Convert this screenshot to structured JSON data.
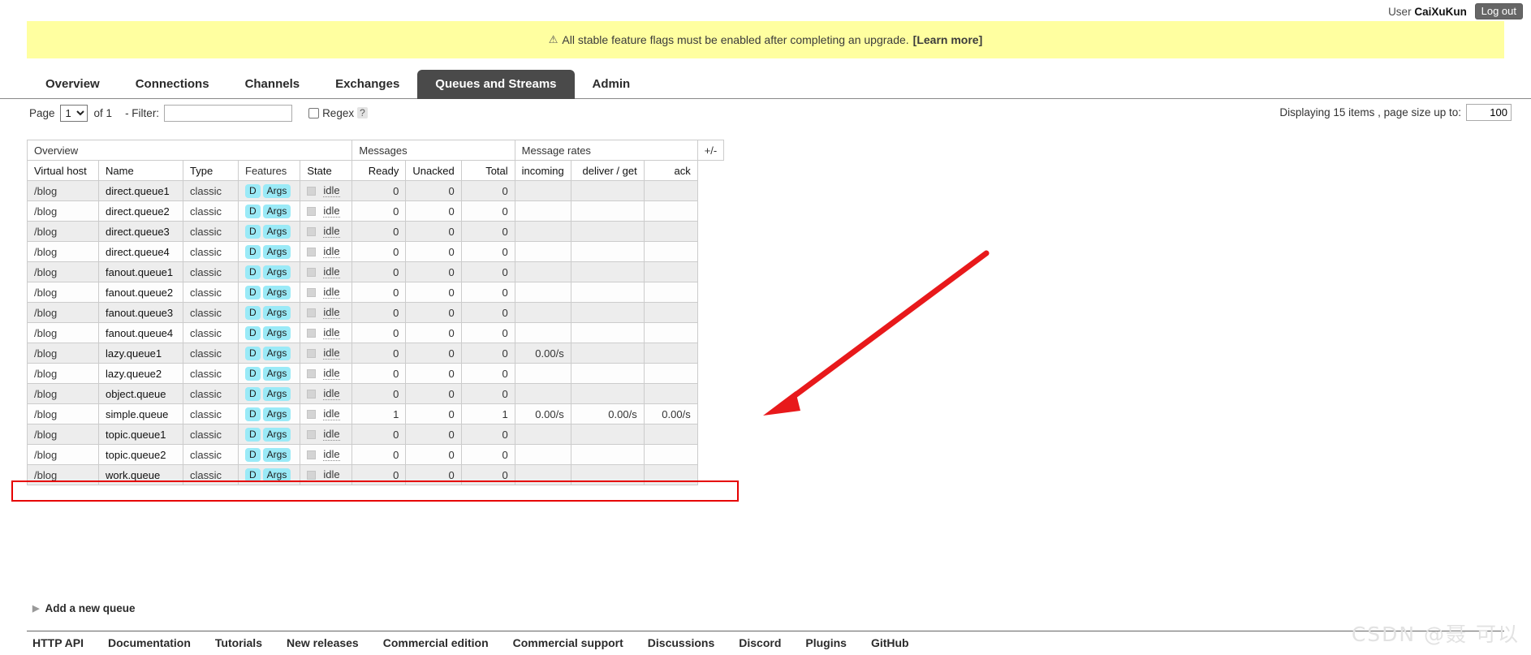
{
  "user": {
    "label": "User",
    "name": "CaiXuKun",
    "logout_label": "Log out"
  },
  "banner": {
    "icon": "warning-triangle-icon",
    "text": "All stable feature flags must be enabled after completing an upgrade.",
    "link_label": "[Learn more]",
    "bg": "#ffffa0"
  },
  "nav": {
    "tabs": [
      {
        "label": "Overview",
        "active": false
      },
      {
        "label": "Connections",
        "active": false
      },
      {
        "label": "Channels",
        "active": false
      },
      {
        "label": "Exchanges",
        "active": false
      },
      {
        "label": "Queues and Streams",
        "active": true
      },
      {
        "label": "Admin",
        "active": false
      }
    ],
    "active_bg": "#4a4a4a"
  },
  "toolbar": {
    "page_label": "Page",
    "page_value": "1",
    "page_options": [
      "1"
    ],
    "of_label": "of 1",
    "filter_label": "- Filter:",
    "filter_value": "",
    "filter_placeholder": "",
    "regex_label": "Regex",
    "regex_checked": false,
    "help_label": "?",
    "displaying_label": "Displaying 15 items , page size up to:",
    "page_size_value": "100"
  },
  "table": {
    "group_headers": [
      {
        "label": "Overview",
        "span": 5
      },
      {
        "label": "Messages",
        "span": 3
      },
      {
        "label": "Message rates",
        "span": 3
      }
    ],
    "plusminus_label": "+/-",
    "columns": [
      {
        "label": "Virtual host",
        "sortable": true,
        "align": "left"
      },
      {
        "label": "Name",
        "sortable": true,
        "align": "left"
      },
      {
        "label": "Type",
        "sortable": true,
        "align": "left"
      },
      {
        "label": "Features",
        "sortable": false,
        "align": "left"
      },
      {
        "label": "State",
        "sortable": true,
        "align": "left"
      },
      {
        "label": "Ready",
        "sortable": true,
        "align": "right"
      },
      {
        "label": "Unacked",
        "sortable": true,
        "align": "right"
      },
      {
        "label": "Total",
        "sortable": true,
        "align": "right"
      },
      {
        "label": "incoming",
        "sortable": true,
        "align": "right"
      },
      {
        "label": "deliver / get",
        "sortable": true,
        "align": "right"
      },
      {
        "label": "ack",
        "sortable": true,
        "align": "right"
      }
    ],
    "feature_badges": {
      "durable": "D",
      "args": "Args"
    },
    "state_text": "idle",
    "rows": [
      {
        "vhost": "/blog",
        "name": "direct.queue1",
        "type": "classic",
        "state": "idle",
        "ready": "0",
        "unacked": "0",
        "total": "0",
        "incoming": "",
        "deliver_get": "",
        "ack": "",
        "highlighted": false
      },
      {
        "vhost": "/blog",
        "name": "direct.queue2",
        "type": "classic",
        "state": "idle",
        "ready": "0",
        "unacked": "0",
        "total": "0",
        "incoming": "",
        "deliver_get": "",
        "ack": "",
        "highlighted": false
      },
      {
        "vhost": "/blog",
        "name": "direct.queue3",
        "type": "classic",
        "state": "idle",
        "ready": "0",
        "unacked": "0",
        "total": "0",
        "incoming": "",
        "deliver_get": "",
        "ack": "",
        "highlighted": false
      },
      {
        "vhost": "/blog",
        "name": "direct.queue4",
        "type": "classic",
        "state": "idle",
        "ready": "0",
        "unacked": "0",
        "total": "0",
        "incoming": "",
        "deliver_get": "",
        "ack": "",
        "highlighted": false
      },
      {
        "vhost": "/blog",
        "name": "fanout.queue1",
        "type": "classic",
        "state": "idle",
        "ready": "0",
        "unacked": "0",
        "total": "0",
        "incoming": "",
        "deliver_get": "",
        "ack": "",
        "highlighted": false
      },
      {
        "vhost": "/blog",
        "name": "fanout.queue2",
        "type": "classic",
        "state": "idle",
        "ready": "0",
        "unacked": "0",
        "total": "0",
        "incoming": "",
        "deliver_get": "",
        "ack": "",
        "highlighted": false
      },
      {
        "vhost": "/blog",
        "name": "fanout.queue3",
        "type": "classic",
        "state": "idle",
        "ready": "0",
        "unacked": "0",
        "total": "0",
        "incoming": "",
        "deliver_get": "",
        "ack": "",
        "highlighted": false
      },
      {
        "vhost": "/blog",
        "name": "fanout.queue4",
        "type": "classic",
        "state": "idle",
        "ready": "0",
        "unacked": "0",
        "total": "0",
        "incoming": "",
        "deliver_get": "",
        "ack": "",
        "highlighted": false
      },
      {
        "vhost": "/blog",
        "name": "lazy.queue1",
        "type": "classic",
        "state": "idle",
        "ready": "0",
        "unacked": "0",
        "total": "0",
        "incoming": "0.00/s",
        "deliver_get": "",
        "ack": "",
        "highlighted": false
      },
      {
        "vhost": "/blog",
        "name": "lazy.queue2",
        "type": "classic",
        "state": "idle",
        "ready": "0",
        "unacked": "0",
        "total": "0",
        "incoming": "",
        "deliver_get": "",
        "ack": "",
        "highlighted": false
      },
      {
        "vhost": "/blog",
        "name": "object.queue",
        "type": "classic",
        "state": "idle",
        "ready": "0",
        "unacked": "0",
        "total": "0",
        "incoming": "",
        "deliver_get": "",
        "ack": "",
        "highlighted": false
      },
      {
        "vhost": "/blog",
        "name": "simple.queue",
        "type": "classic",
        "state": "idle",
        "ready": "1",
        "unacked": "0",
        "total": "1",
        "incoming": "0.00/s",
        "deliver_get": "0.00/s",
        "ack": "0.00/s",
        "highlighted": true
      },
      {
        "vhost": "/blog",
        "name": "topic.queue1",
        "type": "classic",
        "state": "idle",
        "ready": "0",
        "unacked": "0",
        "total": "0",
        "incoming": "",
        "deliver_get": "",
        "ack": "",
        "highlighted": false
      },
      {
        "vhost": "/blog",
        "name": "topic.queue2",
        "type": "classic",
        "state": "idle",
        "ready": "0",
        "unacked": "0",
        "total": "0",
        "incoming": "",
        "deliver_get": "",
        "ack": "",
        "highlighted": false
      },
      {
        "vhost": "/blog",
        "name": "work.queue",
        "type": "classic",
        "state": "idle",
        "ready": "0",
        "unacked": "0",
        "total": "0",
        "incoming": "",
        "deliver_get": "",
        "ack": "",
        "highlighted": false
      }
    ]
  },
  "add_queue": {
    "label": "Add a new queue",
    "expanded": false
  },
  "footer": {
    "links": [
      "HTTP API",
      "Documentation",
      "Tutorials",
      "New releases",
      "Commercial edition",
      "Commercial support",
      "Discussions",
      "Discord",
      "Plugins",
      "GitHub"
    ]
  },
  "annotation": {
    "highlight_color": "#e60000",
    "arrow_color": "#e8191b"
  },
  "watermark": {
    "text": "CSDN @聂 可以"
  }
}
